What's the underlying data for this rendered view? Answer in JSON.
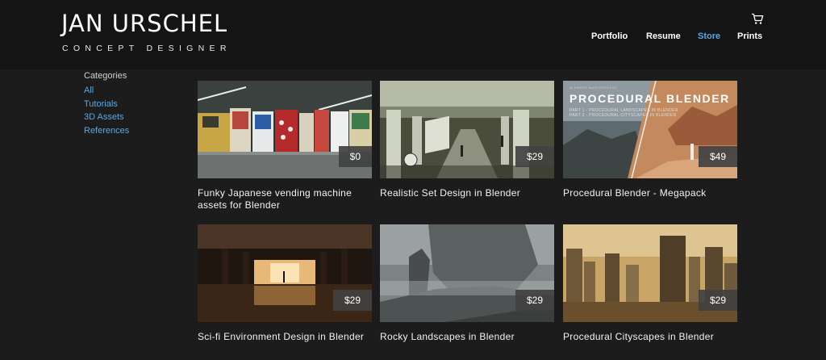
{
  "header": {
    "title": "JAN URSCHEL",
    "subtitle": "CONCEPT DESIGNER",
    "nav": [
      "Portfolio",
      "Resume",
      "Store",
      "Prints"
    ],
    "active_nav": "Store",
    "cart_icon": "shopping-cart-icon"
  },
  "sidebar": {
    "heading": "Categories",
    "categories": [
      "All",
      "Tutorials",
      "3D Assets",
      "References"
    ]
  },
  "products": [
    {
      "title": "Funky Japanese vending machine assets for Blender",
      "price": "$0"
    },
    {
      "title": "Realistic Set Design in Blender",
      "price": "$29"
    },
    {
      "title": "Procedural Blender - Megapack",
      "price": "$49",
      "image_text": {
        "title": "PROCEDURAL BLENDER",
        "line1": "PART 1 - PROCEDURAL LANDSCAPES IN BLENDER",
        "line2": "PART 2 - PROCEDURAL CITYSCAPES IN BLENDER",
        "small": "BLENDER MASTERCLASS"
      }
    },
    {
      "title": "Sci-fi Environment Design in Blender",
      "price": "$29"
    },
    {
      "title": "Rocky Landscapes in Blender",
      "price": "$29"
    },
    {
      "title": "Procedural Cityscapes in Blender",
      "price": "$29"
    }
  ],
  "colors": {
    "accent": "#5aa8e0",
    "background": "#1c1c1c",
    "header": "#141414"
  }
}
